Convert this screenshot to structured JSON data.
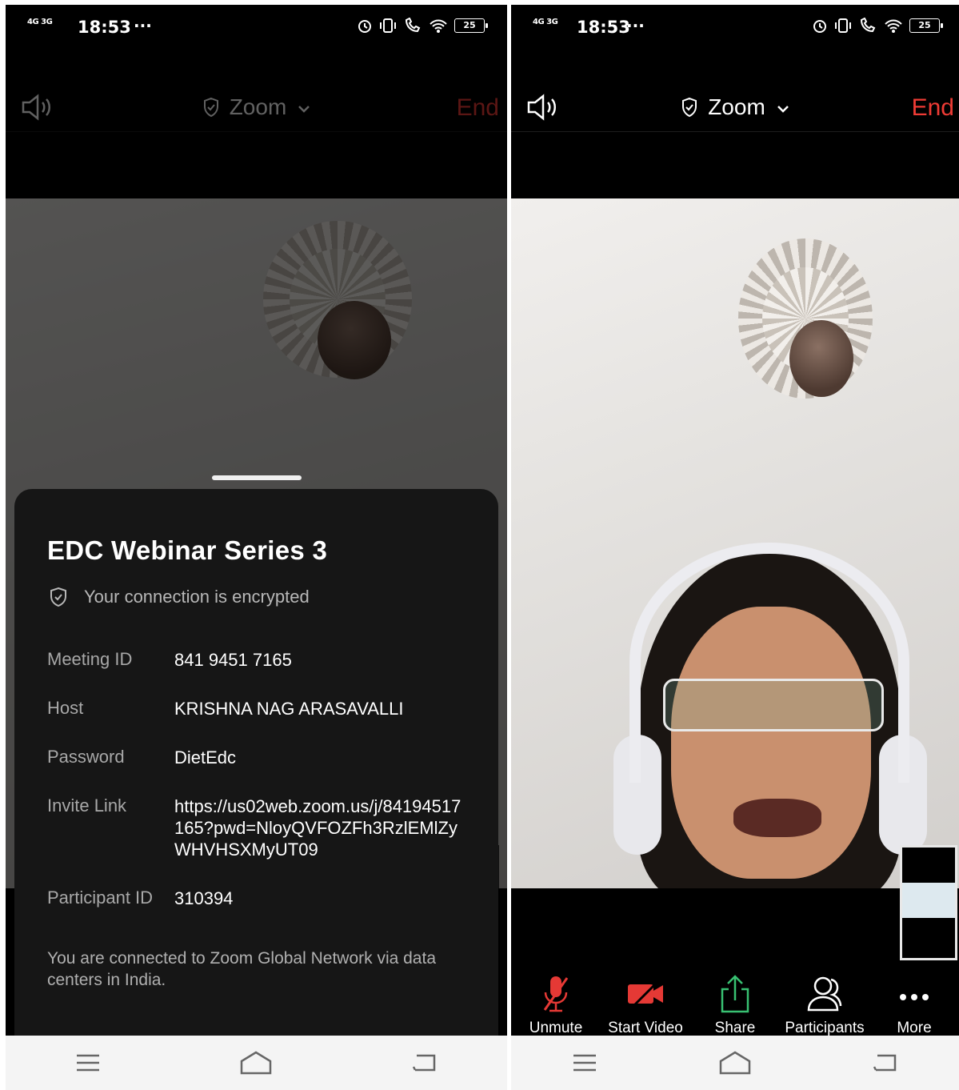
{
  "status_bar": {
    "network_1": "4G",
    "network_2": "3G",
    "time": "18:53",
    "more": "···",
    "battery": "25"
  },
  "header": {
    "app_title": "Zoom",
    "end_label": "End"
  },
  "meeting_info": {
    "title": "EDC Webinar Series 3",
    "encryption_text": "Your connection is encrypted",
    "meeting_id_label": "Meeting ID",
    "meeting_id": "841 9451 7165",
    "host_label": "Host",
    "host": "KRISHNA NAG ARASAVALLI",
    "password_label": "Password",
    "password": "DietEdc",
    "invite_link_label": "Invite Link",
    "invite_link": "https://us02web.zoom.us/j/84194517165?pwd=NloyQVFOZFh3RzlEMlZyWHVHSXMyUT09",
    "participant_id_label": "Participant ID",
    "participant_id": "310394",
    "network_note": "You are connected to Zoom Global Network via data centers in India."
  },
  "toolbar": {
    "unmute": "Unmute",
    "start_video": "Start Video",
    "share": "Share",
    "participants": "Participants",
    "more": "More"
  },
  "colors": {
    "end_red": "#ef3b35",
    "share_green": "#38c172",
    "mic_red": "#e53935"
  }
}
